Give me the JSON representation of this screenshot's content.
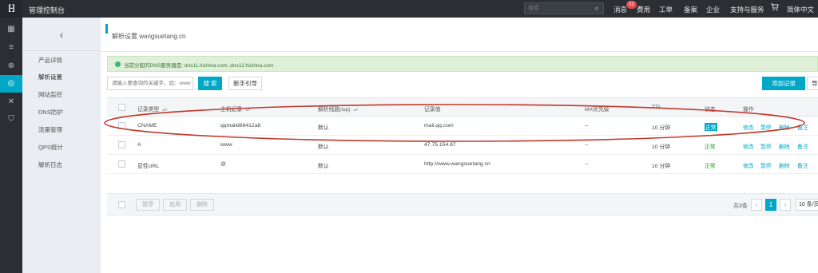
{
  "topbar": {
    "logo": "[-]",
    "title": "管理控制台",
    "search_placeholder": "搜索",
    "messages_label": "消息",
    "messages_count": "52",
    "fees_label": "费用",
    "tickets_label": "工单",
    "filing_label": "备案",
    "enterprise_label": "企业",
    "support_label": "支持与服务",
    "language_label": "简体中文"
  },
  "sidebar": {
    "back_glyph": "‹",
    "items": [
      {
        "label": "产品详情"
      },
      {
        "label": "解析设置"
      },
      {
        "label": "网站监控"
      },
      {
        "label": "DNS防护"
      },
      {
        "label": "流量管理"
      },
      {
        "label": "QPS统计"
      },
      {
        "label": "解析日志"
      }
    ]
  },
  "main": {
    "breadcrumb": "解析设置 wangsuetang.cn",
    "notice": "当前分配的DNS服务器是: dns11.hichina.com, dns12.hichina.com",
    "filter_placeholder": "请输入要查询的关键字，如：www",
    "search_button": "搜 索",
    "guide_button": "新手引导",
    "add_button": "添加记录",
    "import_button": "导入"
  },
  "table": {
    "headers": {
      "type": "记录类型",
      "host": "主机记录",
      "line": "解析线路(isp)",
      "value": "记录值",
      "mx": "MX优先级",
      "ttl": "TTL",
      "status": "状态",
      "actions": "操作"
    },
    "rows": [
      {
        "type": "CNAME",
        "host": "qqmaild66412a8",
        "line": "默认",
        "value": "mail.qq.com",
        "mx": "--",
        "ttl": "10 分钟",
        "status": "正常"
      },
      {
        "type": "A",
        "host": "www",
        "line": "默认",
        "value": "47.75.154.87",
        "mx": "--",
        "ttl": "10 分钟",
        "status": "正常"
      },
      {
        "type": "显性URL",
        "host": "@",
        "line": "默认",
        "value": "http://www.wangsuetang.cn",
        "mx": "--",
        "ttl": "10 分钟",
        "status": "正常"
      }
    ],
    "action_labels": {
      "edit": "修改",
      "pause": "暂停",
      "delete": "删除",
      "note": "备注"
    }
  },
  "footer": {
    "pause_button": "暂停",
    "enable_button": "启用",
    "delete_button": "删除",
    "total": "共3条",
    "prev": "‹",
    "current_page": "1",
    "next": "›",
    "page_size": "10 条/页"
  },
  "colors": {
    "accent": "#00a8c8",
    "topbar": "#2b2f33",
    "sidebar": "#eaedf1",
    "annotation": "#c0392b"
  }
}
